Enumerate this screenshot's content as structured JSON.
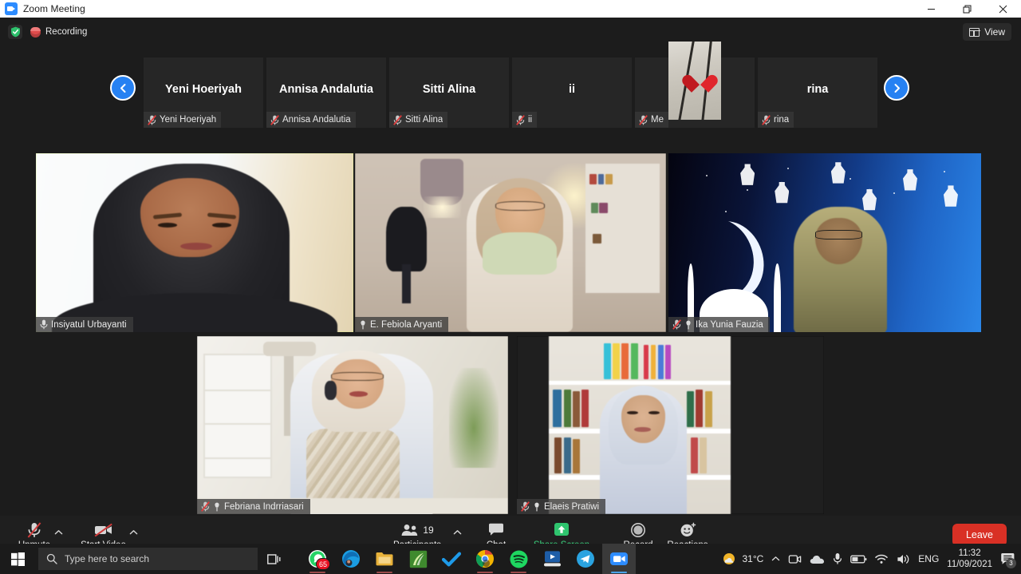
{
  "window": {
    "title": "Zoom Meeting",
    "app_icon": "zoom-icon",
    "minimize": "minimize-icon",
    "maximize": "restore-icon",
    "close": "close-icon"
  },
  "topbar": {
    "encryption_icon": "shield-check-icon",
    "recording_label": "Recording",
    "recording_icon": "record-dot-icon",
    "view_label": "View",
    "view_icon": "grid-icon"
  },
  "filmstrip": {
    "prev_icon": "chevron-left-icon",
    "next_icon": "chevron-right-icon",
    "thumbs": [
      {
        "display_name": "Yeni Hoeriyah",
        "label": "Yeni Hoeriyah",
        "muted": true,
        "has_avatar": false
      },
      {
        "display_name": "Annisa Andalutia",
        "label": "Annisa Andalutia",
        "muted": true,
        "has_avatar": false
      },
      {
        "display_name": "Sitti Alina",
        "label": "Sitti Alina",
        "muted": true,
        "has_avatar": false
      },
      {
        "display_name": "ii",
        "label": "ii",
        "muted": true,
        "has_avatar": false
      },
      {
        "display_name": "",
        "label": "Me",
        "muted": true,
        "has_avatar": true
      },
      {
        "display_name": "rina",
        "label": "rina",
        "muted": true,
        "has_avatar": false
      }
    ]
  },
  "grid": {
    "tiles": [
      {
        "name": "Insiyatul Urbayanti",
        "muted": false,
        "pinned": true,
        "active_speaker": true
      },
      {
        "name": "E. Febiola Aryanti",
        "muted": false,
        "pinned": true,
        "active_speaker": false
      },
      {
        "name": "Ika Yunia Fauzia",
        "muted": true,
        "pinned": true,
        "active_speaker": false
      },
      {
        "name": "Febriana Indrriasari",
        "muted": true,
        "pinned": true,
        "active_speaker": false
      },
      {
        "name": "Elaeis Pratiwi",
        "muted": true,
        "pinned": true,
        "active_speaker": false
      }
    ]
  },
  "toolbar": {
    "mute_label": "Unmute",
    "mute_icon": "mic-off-icon",
    "video_label": "Start Video",
    "video_icon": "video-off-icon",
    "participants_label": "Participants",
    "participants_icon": "people-icon",
    "participants_count": "19",
    "chat_label": "Chat",
    "chat_icon": "chat-bubble-icon",
    "share_label": "Share Screen",
    "share_icon": "share-up-arrow-icon",
    "record_label": "Record",
    "record_icon": "record-circle-icon",
    "reactions_label": "Reactions",
    "reactions_icon": "smiley-plus-icon",
    "leave_label": "Leave",
    "caret_icon": "chevron-up-icon",
    "share_accent_color": "#3ad07c",
    "leave_color": "#d93025"
  },
  "taskbar": {
    "start_icon": "windows-start-icon",
    "search_placeholder": "Type here to search",
    "search_icon": "search-icon",
    "taskview_icon": "task-view-icon",
    "apps": [
      {
        "name": "whatsapp-icon",
        "badge": "65",
        "running": true,
        "active": false
      },
      {
        "name": "edge-icon",
        "badge": "",
        "running": false,
        "active": false
      },
      {
        "name": "file-explorer-icon",
        "badge": "",
        "running": true,
        "active": false
      },
      {
        "name": "green-app-icon",
        "badge": "",
        "running": false,
        "active": false
      },
      {
        "name": "checkmark-app-icon",
        "badge": "",
        "running": false,
        "active": false
      },
      {
        "name": "chrome-icon",
        "badge": "",
        "running": true,
        "active": false
      },
      {
        "name": "spotify-icon",
        "badge": "",
        "running": true,
        "active": false
      },
      {
        "name": "media-app-icon",
        "badge": "",
        "running": false,
        "active": false
      },
      {
        "name": "telegram-icon",
        "badge": "",
        "running": false,
        "active": false
      },
      {
        "name": "zoom-app-icon",
        "badge": "",
        "running": true,
        "active": true
      }
    ],
    "tray": {
      "weather_temp": "31°C",
      "weather_icon": "partly-sunny-icon",
      "overflow_icon": "chevron-up-icon",
      "icons": [
        "meet-now-icon",
        "onedrive-icon",
        "microphone-icon",
        "battery-icon",
        "wifi-icon",
        "volume-icon"
      ],
      "language": "ENG",
      "time": "11:32",
      "date": "11/09/2021",
      "notification_icon": "action-center-icon",
      "notification_count": "3"
    }
  }
}
